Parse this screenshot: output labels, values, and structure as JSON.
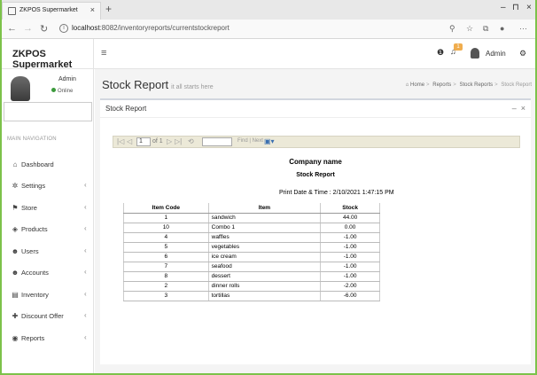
{
  "browser": {
    "tab_title": "ZKPOS Supermarket",
    "tab_close": "×",
    "new_tab": "+",
    "url_host": "localhost",
    "url_path": ":8082/inventoryreports/currentstockreport"
  },
  "header": {
    "brand": "ZKPOS Supermarket",
    "notification_count": "1",
    "user_name": "Admin"
  },
  "sidebar": {
    "user_name": "Admin",
    "user_status": "Online",
    "nav_heading": "MAIN NAVIGATION",
    "items": [
      {
        "label": "Dashboard",
        "icon": "dashboard-icon",
        "glyph": "⌂",
        "has_children": false
      },
      {
        "label": "Settings",
        "icon": "gear-icon",
        "glyph": "✲",
        "has_children": true
      },
      {
        "label": "Store",
        "icon": "store-icon",
        "glyph": "⚑",
        "has_children": true
      },
      {
        "label": "Products",
        "icon": "products-icon",
        "glyph": "◈",
        "has_children": true
      },
      {
        "label": "Users",
        "icon": "users-icon",
        "glyph": "☻",
        "has_children": true
      },
      {
        "label": "Accounts",
        "icon": "accounts-icon",
        "glyph": "☻",
        "has_children": true
      },
      {
        "label": "Inventory",
        "icon": "inventory-icon",
        "glyph": "▤",
        "has_children": true
      },
      {
        "label": "Discount Offer",
        "icon": "discount-icon",
        "glyph": "✚",
        "has_children": true
      },
      {
        "label": "Reports",
        "icon": "reports-icon",
        "glyph": "◉",
        "has_children": true
      }
    ]
  },
  "page": {
    "title": "Stock Report",
    "subtitle": "it all starts here",
    "breadcrumb": [
      "Home",
      "Reports",
      "Stock Reports",
      "Stock Report"
    ]
  },
  "box": {
    "title": "Stock Report"
  },
  "report_viewer": {
    "page_value": "1",
    "of_text": "of 1",
    "find_label": "Find | Next"
  },
  "report": {
    "company": "Company name",
    "title": "Stock Report",
    "print_date": "Print Date & Time : 2/10/2021 1:47:15 PM",
    "columns": [
      "Item Code",
      "Item",
      "Stock"
    ],
    "rows": [
      {
        "code": "1",
        "item": "sandwich",
        "stock": "44.00"
      },
      {
        "code": "10",
        "item": "Combo 1",
        "stock": "0.00"
      },
      {
        "code": "4",
        "item": "waffles",
        "stock": "-1.00"
      },
      {
        "code": "5",
        "item": "vegetables",
        "stock": "-1.00"
      },
      {
        "code": "6",
        "item": "ice cream",
        "stock": "-1.00"
      },
      {
        "code": "7",
        "item": "seafood",
        "stock": "-1.00"
      },
      {
        "code": "8",
        "item": "dessert",
        "stock": "-1.00"
      },
      {
        "code": "2",
        "item": "dinner rolls",
        "stock": "-2.00"
      },
      {
        "code": "3",
        "item": "tortillas",
        "stock": "-6.00"
      }
    ]
  }
}
